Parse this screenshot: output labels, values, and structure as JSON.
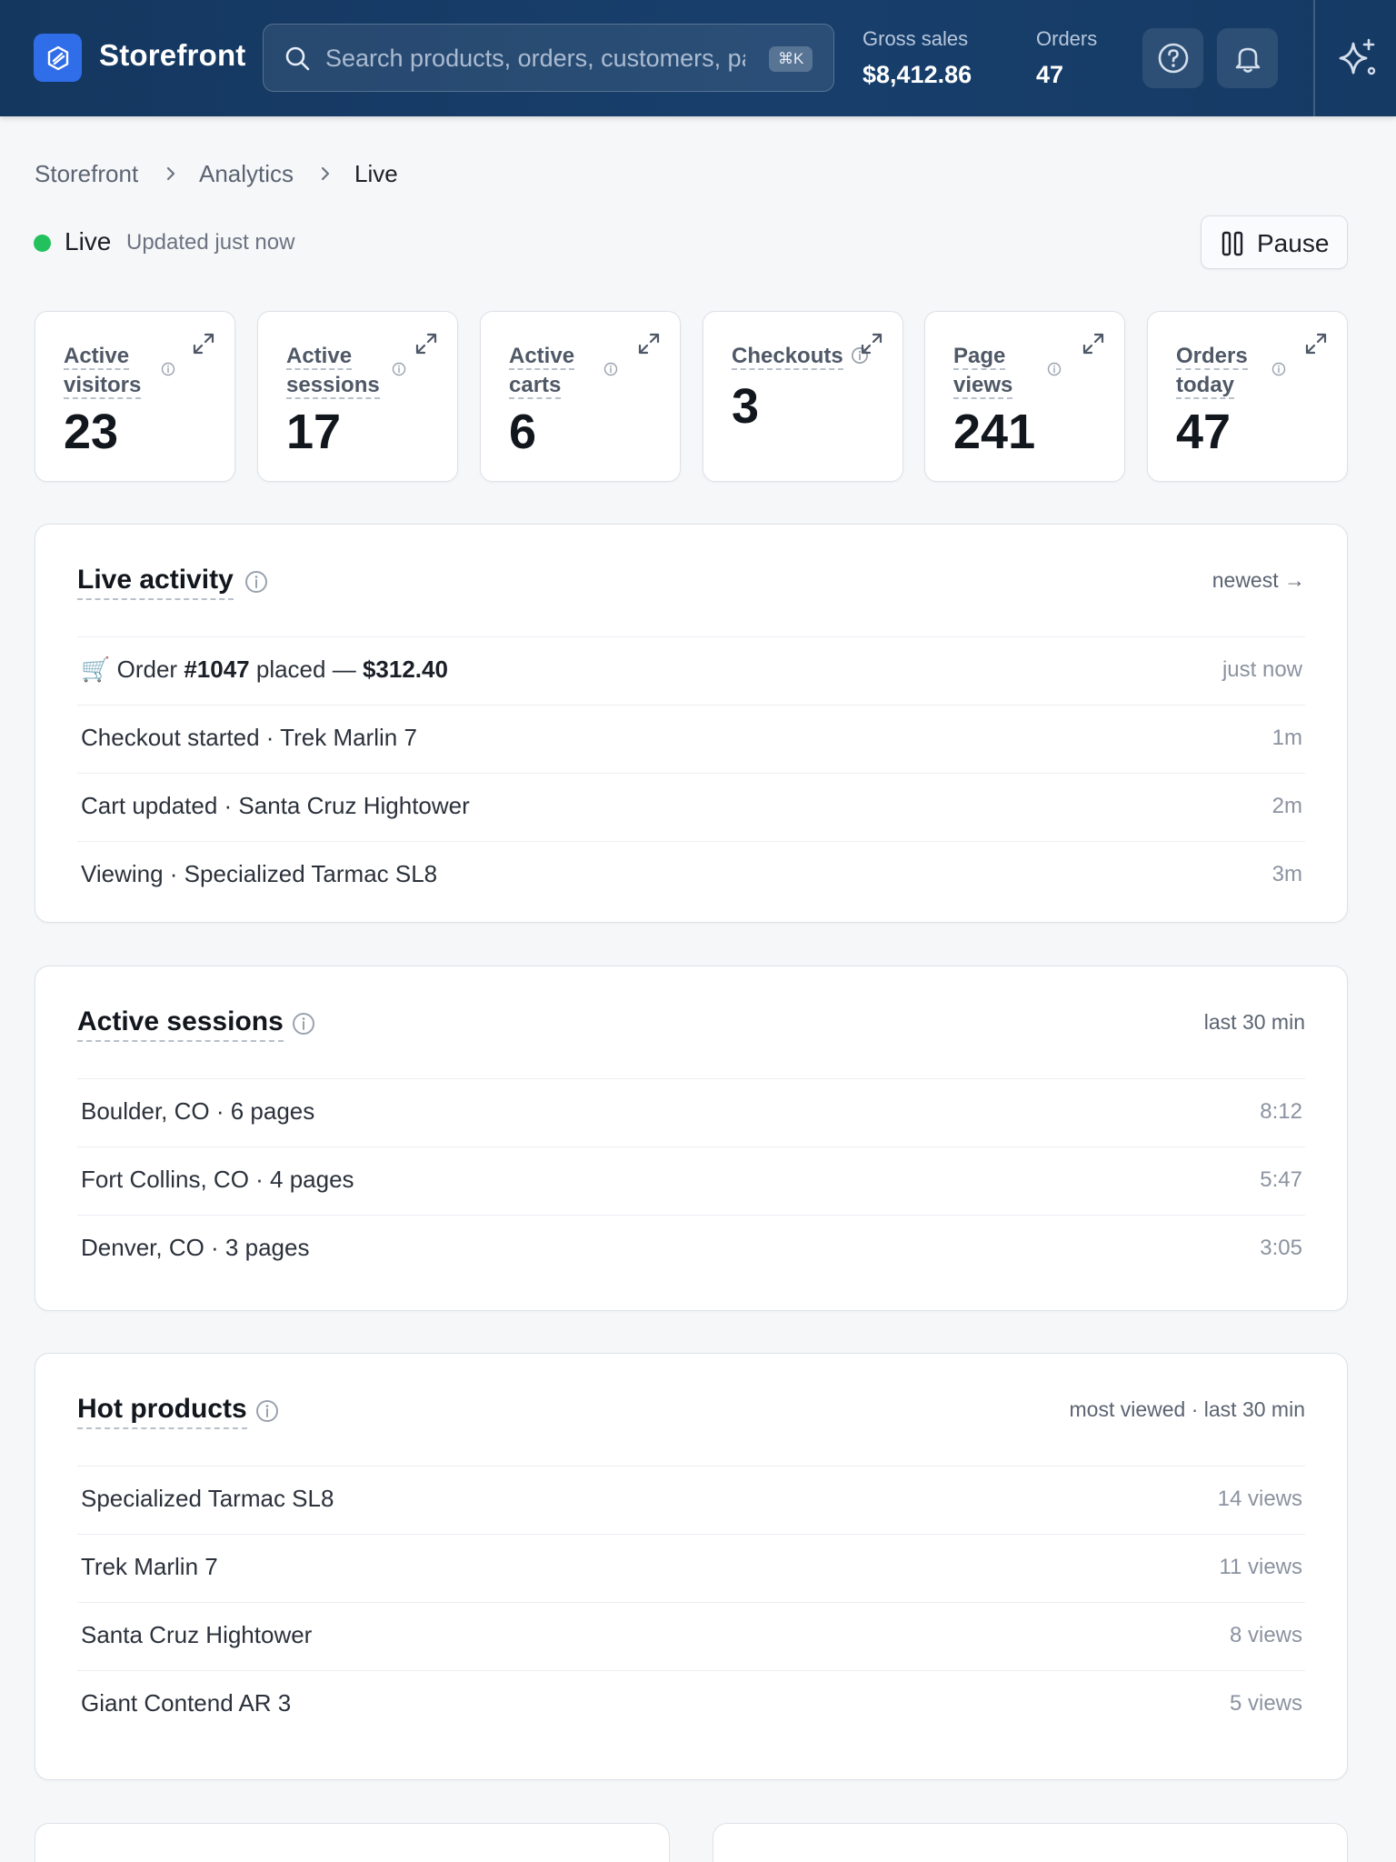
{
  "app": {
    "name": "Storefront"
  },
  "search": {
    "placeholder": "Search products, orders, customers, pages…",
    "shortcut": "⌘K"
  },
  "header_stats": [
    {
      "label": "Gross sales",
      "value": "$8,412.86"
    },
    {
      "label": "Orders",
      "value": "47"
    }
  ],
  "breadcrumb": [
    "Storefront",
    "Analytics",
    "Live"
  ],
  "live": {
    "status": "Live",
    "updated": "Updated just now",
    "status_color": "#22c15e"
  },
  "pause_button": {
    "label": "Pause"
  },
  "metrics": [
    {
      "label_lines": [
        "Active",
        "visitors"
      ],
      "value": "23"
    },
    {
      "label_lines": [
        "Active",
        "sessions"
      ],
      "value": "17"
    },
    {
      "label_lines": [
        "Active",
        "carts"
      ],
      "value": "6"
    },
    {
      "label_lines": [
        "Checkouts"
      ],
      "value": "3"
    },
    {
      "label_lines": [
        "Page",
        "views"
      ],
      "value": "241"
    },
    {
      "label_lines": [
        "Orders",
        "today"
      ],
      "value": "47"
    }
  ],
  "live_activity": {
    "title": "Live activity",
    "meta": "newest →",
    "order_event": {
      "icon": "🛒",
      "prefix": "Order",
      "order_number": "#1047",
      "middle": "placed —",
      "amount": "$312.40",
      "time": "just now"
    },
    "events": [
      {
        "text": "Checkout started · Trek Marlin 7",
        "time": "1m"
      },
      {
        "text": "Cart updated · Santa Cruz Hightower",
        "time": "2m"
      },
      {
        "text": "Viewing · Specialized Tarmac SL8",
        "time": "3m"
      }
    ]
  },
  "active_sessions": {
    "title": "Active sessions",
    "meta": "last 30 min",
    "rows": [
      {
        "text": "Boulder, CO · 6 pages",
        "time": "8:12"
      },
      {
        "text": "Fort Collins, CO · 4 pages",
        "time": "5:47"
      },
      {
        "text": "Denver, CO · 3 pages",
        "time": "3:05"
      }
    ]
  },
  "hot_products": {
    "title": "Hot products",
    "meta": "most viewed · last 30 min",
    "rows": [
      {
        "text": "Specialized Tarmac SL8",
        "time": "14 views"
      },
      {
        "text": "Trek Marlin 7",
        "time": "11 views"
      },
      {
        "text": "Santa Cruz Hightower",
        "time": "8 views"
      },
      {
        "text": "Giant Contend AR 3",
        "time": "5 views"
      }
    ]
  },
  "icons": {
    "brand": "storefront-logo-icon",
    "search": "search-icon",
    "help": "help-icon",
    "notifications": "bell-icon",
    "assistant": "sparkle-icon",
    "pause": "pause-icon",
    "expand": "expand-icon",
    "info": "info-icon",
    "breadcrumb_separator": "chevron-right-icon"
  }
}
